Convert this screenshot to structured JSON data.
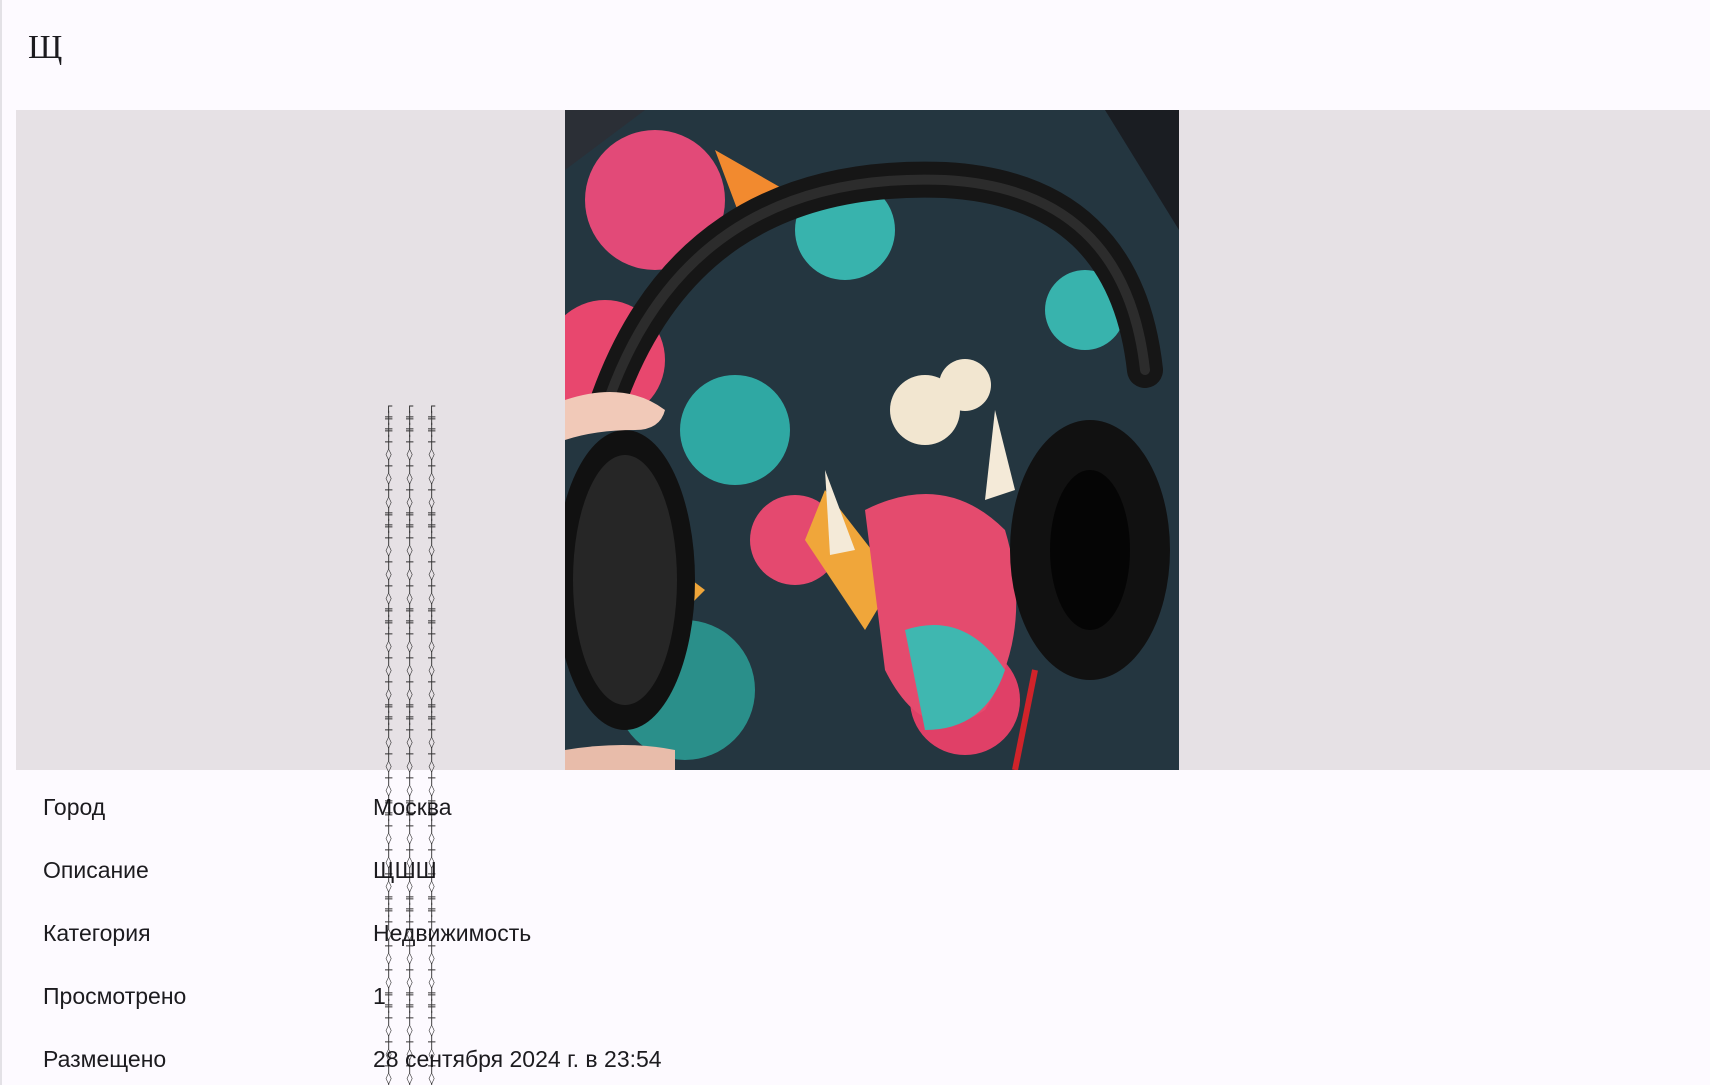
{
  "header": {
    "title": "Щ"
  },
  "gallery": {
    "image_icon": "photo-headphones-on-mousepad",
    "background_color": "#e6e1e5"
  },
  "details": {
    "rows": [
      {
        "label": "Город",
        "value": "Москва"
      },
      {
        "label": "Описание",
        "value": "ЩШШ"
      },
      {
        "label": "Категория",
        "value": "Недвижимость"
      },
      {
        "label": "Просмотрено",
        "value": "1"
      },
      {
        "label": "Размещено",
        "value": "28 сентября 2024 г. в 23:54"
      }
    ]
  }
}
